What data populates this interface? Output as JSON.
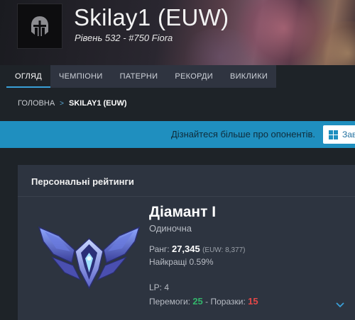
{
  "profile": {
    "name": "Skilay1 (EUW)",
    "subtitle": "Рівень 532 - #750 Fiora",
    "avatar_icon": "spartan-helmet-icon"
  },
  "tabs": [
    {
      "label": "ОГЛЯД",
      "active": true
    },
    {
      "label": "ЧЕМПІОНИ",
      "active": false
    },
    {
      "label": "ПАТЕРНИ",
      "active": false
    },
    {
      "label": "РЕКОРДИ",
      "active": false
    },
    {
      "label": "ВИКЛИКИ",
      "active": false
    }
  ],
  "breadcrumb": {
    "home": "ГОЛОВНА",
    "separator": ">",
    "current": "SKILAY1 (EUW)"
  },
  "banner": {
    "text": "Дізнайтеся більше про опонентів.",
    "button_label": "Зав",
    "button_icon": "windows-logo-icon",
    "color": "#1f8fbf"
  },
  "ratings": {
    "title": "Персональні рейтинги",
    "emblem_icon": "diamond-rank-emblem-icon",
    "tier": "Діамант I",
    "queue": "Одиночна",
    "rank_label": "Ранг:",
    "rank_value": "27,345",
    "rank_region": "(EUW: 8,377)",
    "best_label": "Найкращі",
    "best_value": "0.59%",
    "lp_label": "LP:",
    "lp_value": "4",
    "wins_label": "Перемоги:",
    "wins_value": "25",
    "wl_separator": "-",
    "losses_label": "Поразки:",
    "losses_value": "15",
    "wins_color": "#33b56b",
    "losses_color": "#e54848"
  }
}
